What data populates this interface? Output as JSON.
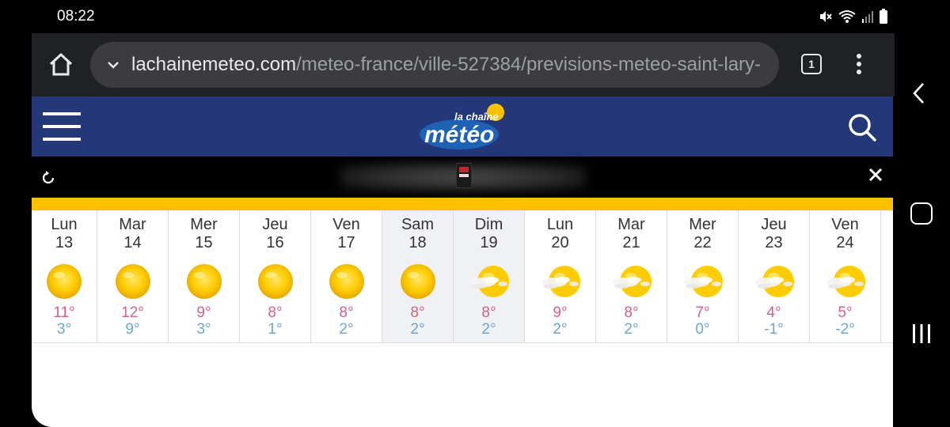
{
  "status_bar": {
    "time": "08:22",
    "icons": [
      "mute-icon",
      "wifi-icon",
      "signal-icon",
      "battery-icon"
    ]
  },
  "browser": {
    "url_host": "lachainemeteo.com",
    "url_path": "/meteo-france/ville-527384/previsions-meteo-saint-lary-",
    "tab_count": "1"
  },
  "site": {
    "logo_line1": "la chaîne",
    "logo_line2": "météo",
    "colors": {
      "header": "#243778",
      "accent": "#ffc000",
      "max_temp": "#d36283",
      "min_temp": "#6fa5cf",
      "weekend": "#f0f1f5"
    }
  },
  "forecast": [
    {
      "day": "Lun",
      "date": "13",
      "icon": "sun-icon",
      "max": "11°",
      "min": "3°",
      "weekend": false
    },
    {
      "day": "Mar",
      "date": "14",
      "icon": "sun-icon",
      "max": "12°",
      "min": "9°",
      "weekend": false
    },
    {
      "day": "Mer",
      "date": "15",
      "icon": "sun-icon",
      "max": "9°",
      "min": "3°",
      "weekend": false
    },
    {
      "day": "Jeu",
      "date": "16",
      "icon": "sun-icon",
      "max": "8°",
      "min": "1°",
      "weekend": false
    },
    {
      "day": "Ven",
      "date": "17",
      "icon": "sun-icon",
      "max": "8°",
      "min": "2°",
      "weekend": false
    },
    {
      "day": "Sam",
      "date": "18",
      "icon": "sun-icon",
      "max": "8°",
      "min": "2°",
      "weekend": true
    },
    {
      "day": "Dim",
      "date": "19",
      "icon": "sun-haze-icon",
      "max": "8°",
      "min": "2°",
      "weekend": true
    },
    {
      "day": "Lun",
      "date": "20",
      "icon": "sun-haze-icon",
      "max": "9°",
      "min": "2°",
      "weekend": false
    },
    {
      "day": "Mar",
      "date": "21",
      "icon": "sun-haze-icon",
      "max": "8°",
      "min": "2°",
      "weekend": false
    },
    {
      "day": "Mer",
      "date": "22",
      "icon": "sun-haze-icon",
      "max": "7°",
      "min": "0°",
      "weekend": false
    },
    {
      "day": "Jeu",
      "date": "23",
      "icon": "sun-haze-icon",
      "max": "4°",
      "min": "-1°",
      "weekend": false
    },
    {
      "day": "Ven",
      "date": "24",
      "icon": "sun-haze-icon",
      "max": "5°",
      "min": "-2°",
      "weekend": false
    }
  ]
}
